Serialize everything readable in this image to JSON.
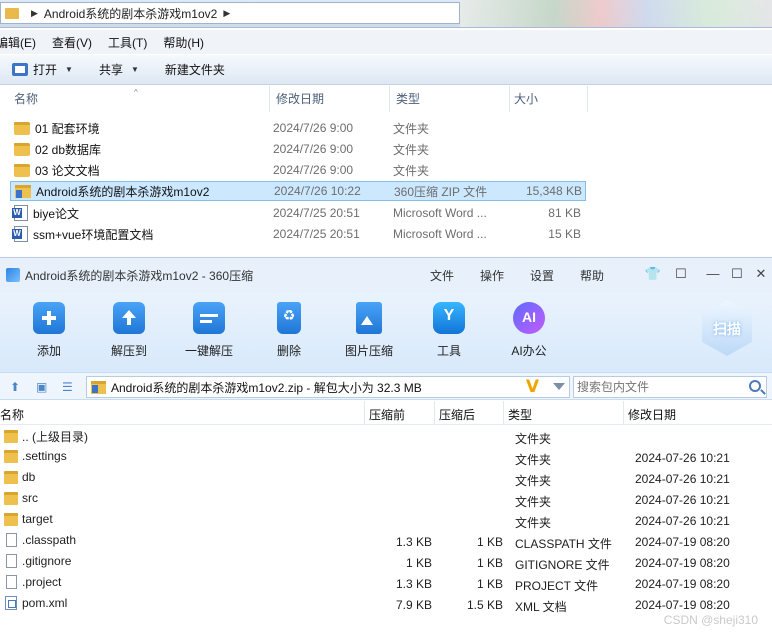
{
  "explorer": {
    "breadcrumb": "Android系统的剧本杀游戏m1ov2",
    "menu": [
      "编辑(E)",
      "查看(V)",
      "工具(T)",
      "帮助(H)"
    ],
    "commands": {
      "open": "打开",
      "share": "共享",
      "new_folder": "新建文件夹"
    },
    "columns": {
      "name": "名称",
      "modified": "修改日期",
      "type": "类型",
      "size": "大小"
    },
    "files": [
      {
        "name": "01 配套环境",
        "modified": "2024/7/26 9:00",
        "type": "文件夹",
        "size": "",
        "icon": "folder"
      },
      {
        "name": "02 db数据库",
        "modified": "2024/7/26 9:00",
        "type": "文件夹",
        "size": "",
        "icon": "folder"
      },
      {
        "name": "03 论文文档",
        "modified": "2024/7/26 9:00",
        "type": "文件夹",
        "size": "",
        "icon": "folder"
      },
      {
        "name": "Android系统的剧本杀游戏m1ov2",
        "modified": "2024/7/26 10:22",
        "type": "360压缩 ZIP 文件",
        "size": "15,348 KB",
        "icon": "zip",
        "selected": true
      },
      {
        "name": "biye论文",
        "modified": "2024/7/25 20:51",
        "type": "Microsoft Word ...",
        "size": "81 KB",
        "icon": "word"
      },
      {
        "name": "ssm+vue环境配置文档",
        "modified": "2024/7/25 20:51",
        "type": "Microsoft Word ...",
        "size": "15 KB",
        "icon": "word"
      }
    ]
  },
  "zip": {
    "title": "Android系统的剧本杀游戏m1ov2 - 360压缩",
    "menu": {
      "file": "文件",
      "operate": "操作",
      "settings": "设置",
      "help": "帮助"
    },
    "tools": {
      "add": "添加",
      "extract_to": "解压到",
      "one_click": "一键解压",
      "delete": "删除",
      "image_compress": "图片压缩",
      "tools": "工具",
      "ai_office": "AI办公",
      "scan": "扫描"
    },
    "path": "Android系统的剧本杀游戏m1ov2.zip - 解包大小为 32.3 MB",
    "search_placeholder": "搜索包内文件",
    "columns": {
      "name": "名称",
      "before": "压缩前",
      "after": "压缩后",
      "type": "类型",
      "modified": "修改日期"
    },
    "entries": [
      {
        "name": ".. (上级目录)",
        "before": "",
        "after": "",
        "type": "文件夹",
        "modified": "",
        "icon": "folder"
      },
      {
        "name": ".settings",
        "before": "",
        "after": "",
        "type": "文件夹",
        "modified": "2024-07-26 10:21",
        "icon": "folder"
      },
      {
        "name": "db",
        "before": "",
        "after": "",
        "type": "文件夹",
        "modified": "2024-07-26 10:21",
        "icon": "folder"
      },
      {
        "name": "src",
        "before": "",
        "after": "",
        "type": "文件夹",
        "modified": "2024-07-26 10:21",
        "icon": "folder"
      },
      {
        "name": "target",
        "before": "",
        "after": "",
        "type": "文件夹",
        "modified": "2024-07-26 10:21",
        "icon": "folder"
      },
      {
        "name": ".classpath",
        "before": "1.3 KB",
        "after": "1 KB",
        "type": "CLASSPATH 文件",
        "modified": "2024-07-19 08:20",
        "icon": "file"
      },
      {
        "name": ".gitignore",
        "before": "1 KB",
        "after": "1 KB",
        "type": "GITIGNORE 文件",
        "modified": "2024-07-19 08:20",
        "icon": "file"
      },
      {
        "name": ".project",
        "before": "1.3 KB",
        "after": "1 KB",
        "type": "PROJECT 文件",
        "modified": "2024-07-19 08:20",
        "icon": "file"
      },
      {
        "name": "pom.xml",
        "before": "7.9 KB",
        "after": "1.5 KB",
        "type": "XML 文档",
        "modified": "2024-07-19 08:20",
        "icon": "xml"
      }
    ]
  },
  "watermark": "CSDN @sheji310"
}
